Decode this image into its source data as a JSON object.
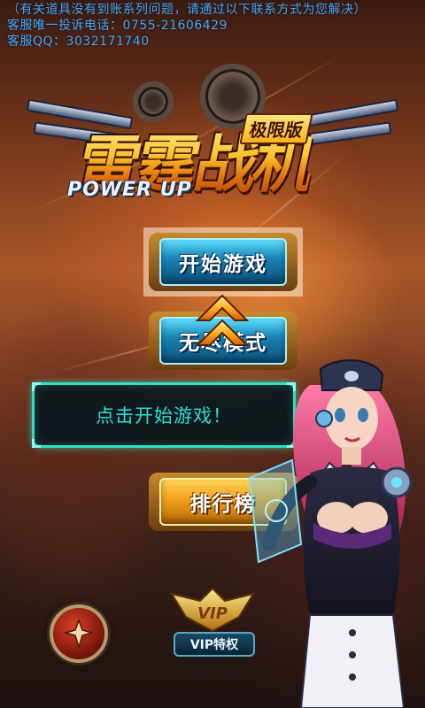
{
  "notice": {
    "line1": "（有关道具没有到账系列问题，请通过以下联系方式为您解决）",
    "line2": "客服唯一投诉电话：0755-21606429",
    "line3": "客服QQ：3032171740"
  },
  "logo": {
    "title": "雷霆战机",
    "badge": "极限版",
    "subtitle": "POWER UP"
  },
  "menu": {
    "start_label": "开始游戏",
    "endless_label": "无尽模式",
    "rank_label": "排行榜"
  },
  "tooltip": {
    "text": "点击开始游戏！"
  },
  "vip": {
    "badge": "VIP",
    "label": "VIP特权"
  },
  "colors": {
    "notice": "#3ea8ff",
    "tooltip_border": "#2fe0c4",
    "tooltip_text": "#24e0d8",
    "button_blue": "#1a86b8",
    "button_gold": "#f2a01a",
    "arrow": "#ffb020"
  },
  "icons": {
    "arrow": "double-chevron-up-icon",
    "round_button": "plane-emblem-icon",
    "vip": "vip-wings-icon"
  }
}
